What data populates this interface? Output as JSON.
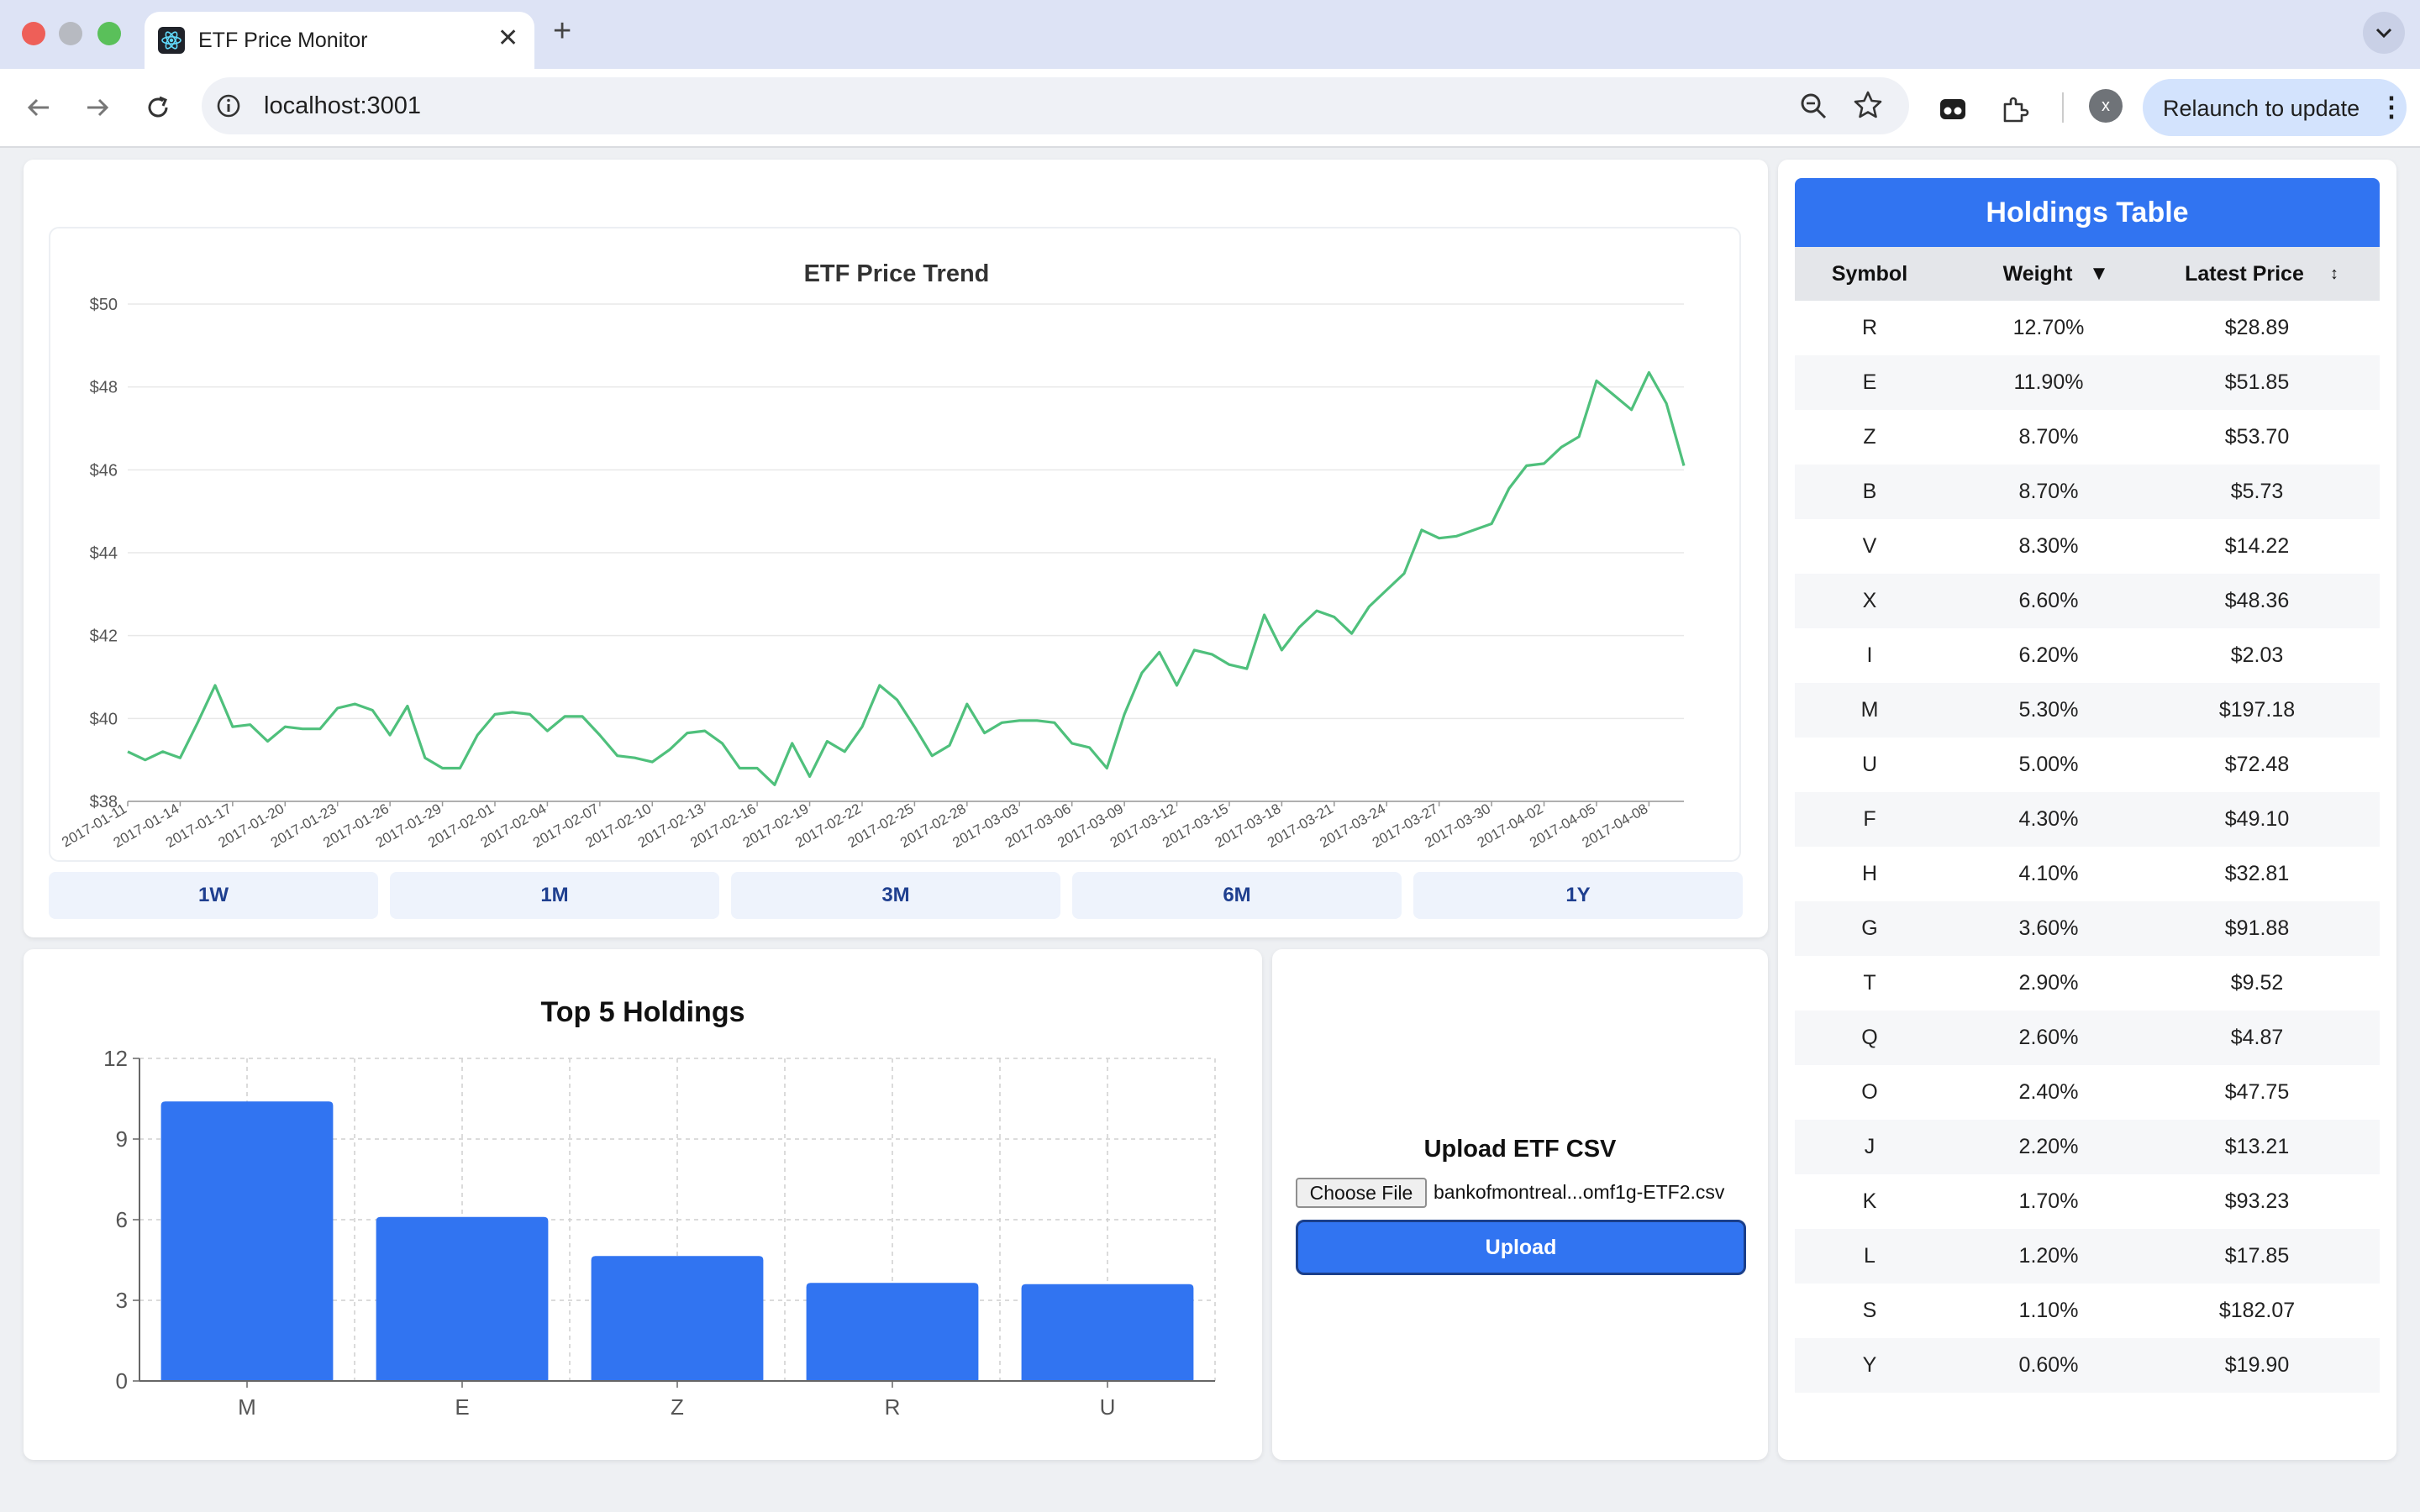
{
  "browser": {
    "tab_title": "ETF Price Monitor",
    "tab_close": "✕",
    "new_tab": "+",
    "url": "localhost:3001",
    "profile_initial": "x",
    "relaunch_label": "Relaunch to update",
    "menu_dots": "⋮"
  },
  "trend": {
    "range_buttons": [
      "1W",
      "1M",
      "3M",
      "6M",
      "1Y"
    ]
  },
  "chart_data": [
    {
      "type": "line",
      "title": "ETF Price Trend",
      "xlabel": "",
      "ylabel": "",
      "ylim": [
        38,
        50
      ],
      "y_ticks": [
        "$38",
        "$40",
        "$42",
        "$44",
        "$46",
        "$48",
        "$50"
      ],
      "x_tick_labels": [
        "2017-01-11",
        "2017-01-14",
        "2017-01-17",
        "2017-01-20",
        "2017-01-23",
        "2017-01-26",
        "2017-01-29",
        "2017-02-01",
        "2017-02-04",
        "2017-02-07",
        "2017-02-10",
        "2017-02-13",
        "2017-02-16",
        "2017-02-19",
        "2017-02-22",
        "2017-02-25",
        "2017-02-28",
        "2017-03-03",
        "2017-03-06",
        "2017-03-09",
        "2017-03-12",
        "2017-03-15",
        "2017-03-18",
        "2017-03-21",
        "2017-03-24",
        "2017-03-27",
        "2017-03-30",
        "2017-04-02",
        "2017-04-05",
        "2017-04-08"
      ],
      "x_start": "2017-01-11",
      "line_color": "#4fc07c",
      "grid": true,
      "series": [
        {
          "values": [
            39.2,
            39.0,
            39.2,
            39.05,
            39.9,
            40.8,
            39.8,
            39.85,
            39.45,
            39.8,
            39.75,
            39.75,
            40.25,
            40.35,
            40.2,
            39.6,
            40.3,
            39.05,
            38.8,
            38.8,
            39.6,
            40.1,
            40.15,
            40.1,
            39.7,
            40.05,
            40.05,
            39.6,
            39.1,
            39.05,
            38.95,
            39.25,
            39.65,
            39.7,
            39.4,
            38.8,
            38.8,
            38.4,
            39.4,
            38.6,
            39.45,
            39.2,
            39.8,
            40.8,
            40.45,
            39.8,
            39.1,
            39.35,
            40.35,
            39.65,
            39.9,
            39.95,
            39.95,
            39.9,
            39.4,
            39.3,
            38.8,
            40.1,
            41.1,
            41.6,
            40.8,
            41.65,
            41.55,
            41.3,
            41.2,
            42.5,
            41.65,
            42.2,
            42.6,
            42.45,
            42.05,
            42.7,
            43.1,
            43.5,
            44.55,
            44.35,
            44.4,
            44.55,
            44.7,
            45.55,
            46.1,
            46.15,
            46.55,
            46.8,
            48.15,
            47.8,
            47.45,
            48.35,
            47.6,
            46.1
          ]
        }
      ]
    },
    {
      "type": "bar",
      "title": "Top 5 Holdings",
      "categories": [
        "M",
        "E",
        "Z",
        "R",
        "U"
      ],
      "values": [
        10.4,
        6.1,
        4.65,
        3.65,
        3.6
      ],
      "ylim": [
        0,
        12
      ],
      "y_ticks": [
        "0",
        "3",
        "6",
        "9",
        "12"
      ],
      "bar_color": "#3174f1",
      "grid": true,
      "xlabel": "",
      "ylabel": ""
    }
  ],
  "upload": {
    "title": "Upload ETF CSV",
    "choose_label": "Choose File",
    "file_name": "bankofmontreal...omf1g-ETF2.csv",
    "upload_label": "Upload"
  },
  "holdings": {
    "title": "Holdings Table",
    "columns": {
      "symbol": "Symbol",
      "weight": "Weight",
      "weight_sort": "▼",
      "price": "Latest Price",
      "price_sort": "↕"
    },
    "rows": [
      {
        "symbol": "R",
        "weight": "12.70%",
        "price": "$28.89"
      },
      {
        "symbol": "E",
        "weight": "11.90%",
        "price": "$51.85"
      },
      {
        "symbol": "Z",
        "weight": "8.70%",
        "price": "$53.70"
      },
      {
        "symbol": "B",
        "weight": "8.70%",
        "price": "$5.73"
      },
      {
        "symbol": "V",
        "weight": "8.30%",
        "price": "$14.22"
      },
      {
        "symbol": "X",
        "weight": "6.60%",
        "price": "$48.36"
      },
      {
        "symbol": "I",
        "weight": "6.20%",
        "price": "$2.03"
      },
      {
        "symbol": "M",
        "weight": "5.30%",
        "price": "$197.18"
      },
      {
        "symbol": "U",
        "weight": "5.00%",
        "price": "$72.48"
      },
      {
        "symbol": "F",
        "weight": "4.30%",
        "price": "$49.10"
      },
      {
        "symbol": "H",
        "weight": "4.10%",
        "price": "$32.81"
      },
      {
        "symbol": "G",
        "weight": "3.60%",
        "price": "$91.88"
      },
      {
        "symbol": "T",
        "weight": "2.90%",
        "price": "$9.52"
      },
      {
        "symbol": "Q",
        "weight": "2.60%",
        "price": "$4.87"
      },
      {
        "symbol": "O",
        "weight": "2.40%",
        "price": "$47.75"
      },
      {
        "symbol": "J",
        "weight": "2.20%",
        "price": "$13.21"
      },
      {
        "symbol": "K",
        "weight": "1.70%",
        "price": "$93.23"
      },
      {
        "symbol": "L",
        "weight": "1.20%",
        "price": "$17.85"
      },
      {
        "symbol": "S",
        "weight": "1.10%",
        "price": "$182.07"
      },
      {
        "symbol": "Y",
        "weight": "0.60%",
        "price": "$19.90"
      }
    ]
  }
}
